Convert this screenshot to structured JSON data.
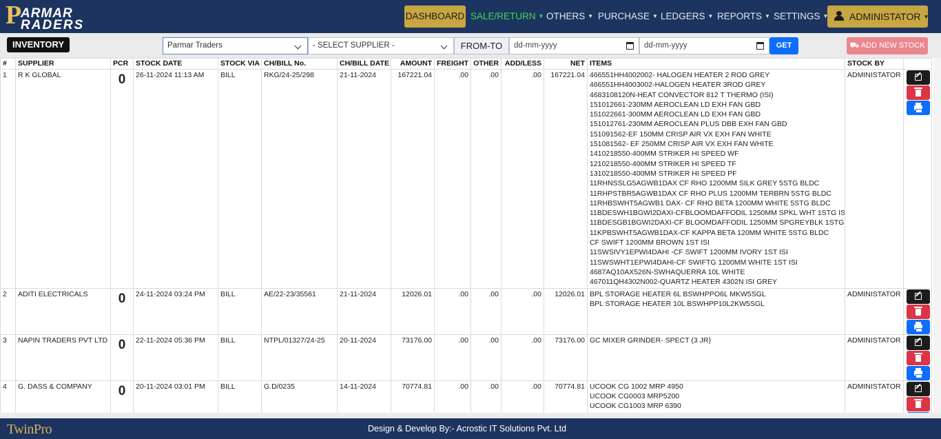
{
  "brand": {
    "letter": "P",
    "line1": "ARMAR",
    "line2": "RADERS"
  },
  "nav": [
    {
      "label": "DASHBOARD",
      "dropdown": false
    },
    {
      "label": "SALE/RETURN",
      "dropdown": true
    },
    {
      "label": "OTHERS",
      "dropdown": true
    },
    {
      "label": "PURCHASE",
      "dropdown": true
    },
    {
      "label": "LEDGERS",
      "dropdown": true
    },
    {
      "label": "REPORTS",
      "dropdown": true
    },
    {
      "label": "SETTINGS",
      "dropdown": true
    },
    {
      "label": "ADMINISTATOR",
      "dropdown": true
    }
  ],
  "toolbar": {
    "title": "INVENTORY",
    "company_select": "Parmar Traders",
    "supplier_select": "- SELECT SUPPLIER -",
    "from_to_label": "FROM-TO",
    "date_from_placeholder": "dd-mm-yyyy",
    "date_to_placeholder": "dd-mm-yyyy",
    "get_label": "GET",
    "add_label": "ADD NEW STOCK"
  },
  "table": {
    "columns": [
      "#",
      "SUPPLIER",
      "PCR",
      "STOCK DATE",
      "STOCK VIA",
      "CH/BILL No.",
      "CH/BILL DATE",
      "AMOUNT",
      "FREIGHT",
      "OTHER",
      "ADD/LESS",
      "NET",
      "ITEMS",
      "STOCK BY"
    ],
    "rows": [
      {
        "no": "1",
        "supplier": "R K GLOBAL",
        "pcr": "0",
        "stock_date": "26-11-2024 11:13 AM",
        "via": "BILL",
        "bill_no": "RKG/24-25/298",
        "bill_date": "21-11-2024",
        "amount": "167221.04",
        "freight": ".00",
        "other": ".00",
        "addless": ".00",
        "net": "167221.04",
        "items": [
          "466551HH4002002- HALOGEN HEATER 2 ROD GREY",
          "466551HH4003002-HALOGEN HEATER 3ROD GREY",
          "4683108120N-HEAT CONVECTOR 812 T THERMO (ISI)",
          "151012661-230MM AEROCLEAN LD EXH FAN GBD",
          "151022661-300MM AEROCLEAN LD EXH FAN GBD",
          "151012761-230MM AEROCLEAN PLUS DBB EXH FAN GBD",
          "151091562-EF 150MM CRISP AIR VX EXH FAN WHITE",
          "151081562- EF 250MM CRISP AIR VX EXH FAN WHITE",
          "1410218550-400MM STRIKER HI SPEED WF",
          "1210218550-400MM STRIKER HI SPEED TF",
          "1310218550-400MM STRIKER HI SPEED PF",
          "11RHNSSLG5AGWB1DAX CF RHO 1200MM SILK GREY 5STG BLDC",
          "11RHPSTBR5AGWB1DAX CF RHO PLUS 1200MM TERBRN 5STG BLDC",
          "11RHBSWHT5AGWB1 DAX- CF RHO BETA 1200MM WHITE 5STG BLDC",
          "11BDESWH1BGWI2DAXI-CFBLOOMDAFFODIL 1250MM SPKL WHT 1STG ISI",
          "11BDESGB1BGWI2DAXI-CF BLOOMDAFFODIL 1250MM SPGREYBLK 1STG ISI",
          "11KPBSWHT5AGWB1DAX-CF KAPPA BETA 120MM WHITE 5STG BLDC",
          "CF SWIFT 1200MM BROWN 1ST ISI",
          "11SWSIVY1EPWI4DAHI -CF SWIFT 1200MM IVORY 1ST ISI",
          "11SWSWHT1EPWI4DAHI-CF SWIFTG 1200MM WHITE 1ST ISI",
          "4687AQ10AX526N-SWHAQUERRA 10L WHITE",
          "467011QH4302N002-QUARTZ HEATER 4302N ISI GREY"
        ],
        "stock_by": "ADMINISTATOR"
      },
      {
        "no": "2",
        "supplier": "ADITI ELECTRICALS",
        "pcr": "0",
        "stock_date": "24-11-2024 03:24 PM",
        "via": "BILL",
        "bill_no": "AE/22-23/35561",
        "bill_date": "21-11-2024",
        "amount": "12026.01",
        "freight": ".00",
        "other": ".00",
        "addless": ".00",
        "net": "12026.01",
        "items": [
          "BPL STORAGE HEATER 6L BSWHPPO6L MKW5SGL",
          "BPL STORAGE HEATER 10L BSWHPP10L2KW5SGL"
        ],
        "stock_by": "ADMINISTATOR"
      },
      {
        "no": "3",
        "supplier": "NAPIN TRADERS PVT LTD",
        "pcr": "0",
        "stock_date": "22-11-2024 05:36 PM",
        "via": "BILL",
        "bill_no": "NTPL/01327/24-25",
        "bill_date": "20-11-2024",
        "amount": "73176.00",
        "freight": ".00",
        "other": ".00",
        "addless": ".00",
        "net": "73176.00",
        "items": [
          "GC MIXER GRINDER- SPECT (3 JR)"
        ],
        "stock_by": "ADMINISTATOR"
      },
      {
        "no": "4",
        "supplier": "G. DASS & COMPANY",
        "pcr": "0",
        "stock_date": "20-11-2024 03:01 PM",
        "via": "BILL",
        "bill_no": "G.D/0235",
        "bill_date": "14-11-2024",
        "amount": "70774.81",
        "freight": ".00",
        "other": ".00",
        "addless": ".00",
        "net": "70774.81",
        "items": [
          "UCOOK CG 1002 MRP 4950",
          "UCOOK CG0003 MRP5200",
          "UCOOK CG1003 MRP 6390"
        ],
        "stock_by": "ADMINISTATOR"
      }
    ]
  },
  "footer": {
    "logo": "TwinPro",
    "credit": "Design & Develop By:- Acrostic IT Solutions Pvt. Ltd"
  }
}
